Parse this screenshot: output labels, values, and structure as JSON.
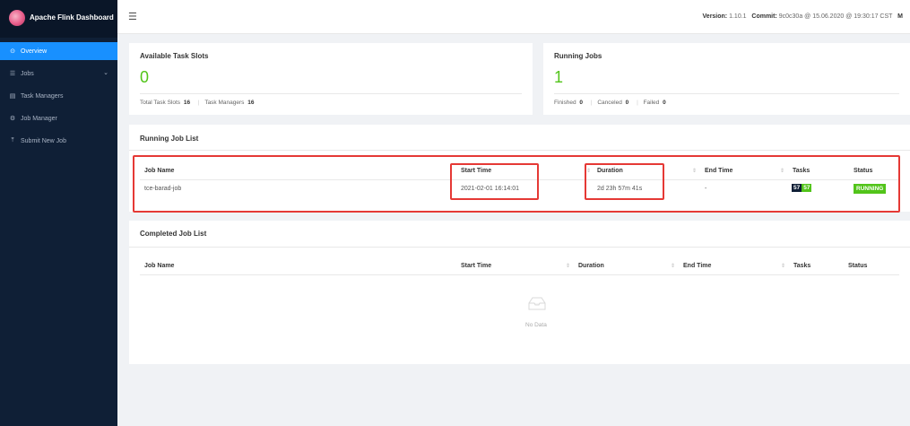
{
  "app": {
    "title": "Apache Flink Dashboard"
  },
  "sidebar": {
    "items": [
      {
        "label": "Overview",
        "icon": "dashboard-icon",
        "glyph": "⊙",
        "active": true
      },
      {
        "label": "Jobs",
        "icon": "jobs-icon",
        "glyph": "☰",
        "caret": "⌄"
      },
      {
        "label": "Task Managers",
        "icon": "task-managers-icon",
        "glyph": "▤"
      },
      {
        "label": "Job Manager",
        "icon": "job-manager-icon",
        "glyph": "⚙"
      },
      {
        "label": "Submit New Job",
        "icon": "upload-icon",
        "glyph": "⤒"
      }
    ]
  },
  "topbar": {
    "toggle_glyph": "☰",
    "version_label": "Version:",
    "version": "1.10.1",
    "commit_label": "Commit:",
    "commit": "9c0c30a @ 15.06.2020 @ 19:30:17 CST",
    "trailing": "M"
  },
  "task_slots": {
    "title": "Available Task Slots",
    "value": "0",
    "total_label": "Total Task Slots",
    "total": "16",
    "tm_label": "Task Managers",
    "tm": "16"
  },
  "running_jobs": {
    "title": "Running Jobs",
    "value": "1",
    "finished_label": "Finished",
    "finished": "0",
    "canceled_label": "Canceled",
    "canceled": "0",
    "failed_label": "Failed",
    "failed": "0"
  },
  "running_list": {
    "title": "Running Job List",
    "columns": [
      "Job Name",
      "Start Time",
      "Duration",
      "End Time",
      "Tasks",
      "Status"
    ],
    "sort_glyph": "⇕",
    "rows": [
      {
        "name": "tce-barad-job",
        "start": "2021-02-01 16:14:01",
        "duration": "2d 23h 57m 41s",
        "end": "-",
        "tasks_total": "57",
        "tasks_running": "57",
        "status": "RUNNING"
      }
    ]
  },
  "completed_list": {
    "title": "Completed Job List",
    "columns": [
      "Job Name",
      "Start Time",
      "Duration",
      "End Time",
      "Tasks",
      "Status"
    ],
    "sort_glyph": "⇕",
    "empty_text": "No Data"
  },
  "colors": {
    "sidebar_bg": "#0f1f36",
    "active": "#1890ff",
    "success": "#52c41a",
    "highlight": "#e53935"
  }
}
